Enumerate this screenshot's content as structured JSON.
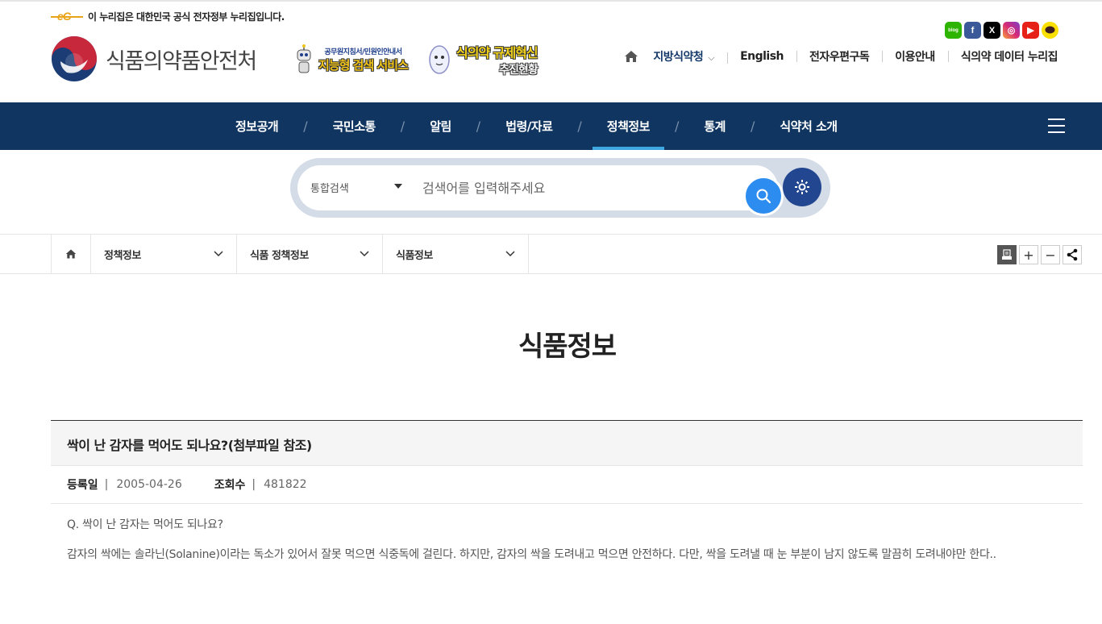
{
  "header": {
    "gov_banner_text": "이 누리집은 대한민국 공식 전자정부 누리집입니다.",
    "eg_logo_text": "eG",
    "logo_text": "식품의약품안전처",
    "banner1": {
      "small": "공무원지침서/민원인안내서",
      "big": "지능형 검색 서비스"
    },
    "banner2": {
      "big": "식의약 규제혁신",
      "big2": "추진현황"
    },
    "sns": [
      {
        "name": "blog",
        "glyph": "blog",
        "color": "#2db400"
      },
      {
        "name": "facebook",
        "glyph": "f",
        "color": "#3b5998"
      },
      {
        "name": "x",
        "glyph": "X",
        "color": "#000000"
      },
      {
        "name": "instagram",
        "glyph": "◎",
        "color": "#d62976"
      },
      {
        "name": "youtube",
        "glyph": "▶",
        "color": "#e62117"
      },
      {
        "name": "kakao",
        "glyph": "💬",
        "color": "#f9e000"
      }
    ],
    "util_links": {
      "regional": "지방식약청",
      "english": "English",
      "newsletter": "전자우편구독",
      "guide": "이용안내",
      "data_portal": "식의약 데이터 누리집"
    }
  },
  "gnb": {
    "items": [
      "정보공개",
      "국민소통",
      "알림",
      "법령/자료",
      "정책정보",
      "통계",
      "식약처 소개"
    ],
    "active_index": 4,
    "separator": "/"
  },
  "search": {
    "scope": "통합검색",
    "placeholder": "검색어를 입력해주세요"
  },
  "breadcrumb": {
    "items": [
      "정책정보",
      "식품 정책정보",
      "식품정보"
    ]
  },
  "tools": {
    "zoom_in": "+",
    "zoom_out": "−"
  },
  "page": {
    "title": "식품정보"
  },
  "post": {
    "title": "싹이 난 감자를 먹어도 되나요?(첨부파일 참조)",
    "date_label": "등록일",
    "date": "2005-04-26",
    "views_label": "조회수",
    "views": "481822",
    "meta_separator": "|",
    "question": "Q. 싹이 난 감자는 먹어도 되나요?",
    "answer": "감자의 싹에는 솔라닌(Solanine)이라는 독소가 있어서 잘못 먹으면 식중독에 걸린다. 하지만, 감자의 싹을 도려내고 먹으면 안전하다. 다만, 싹을 도려낼 때 눈 부분이 남지 않도록 말끔히 도려내야만 한다.."
  },
  "colors": {
    "gnb_bg": "#0f3560",
    "gnb_active": "#3ea6e0",
    "search_btn": "#2d8cf0",
    "settings_btn": "#22468f"
  }
}
